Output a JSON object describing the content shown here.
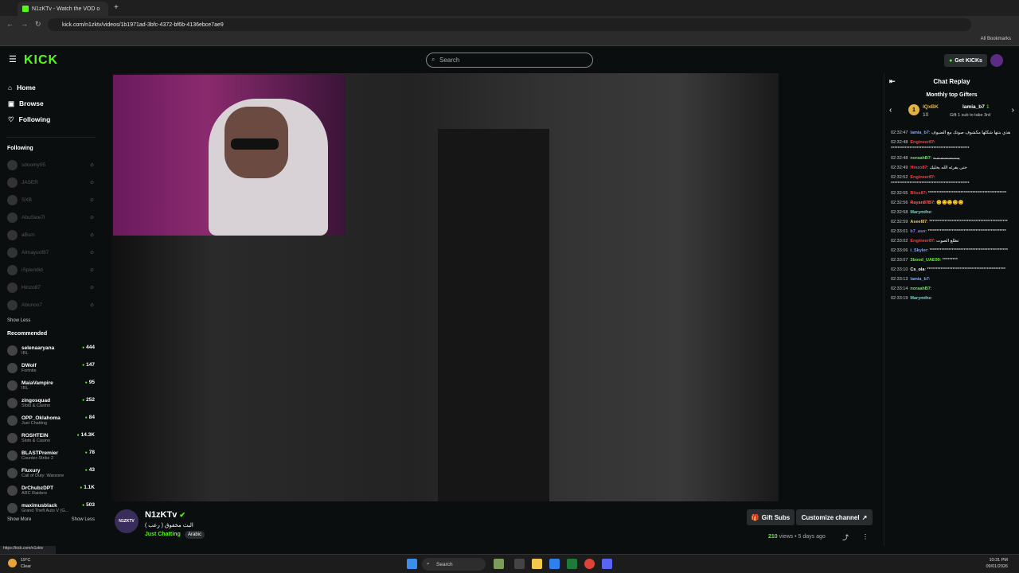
{
  "browser": {
    "tab_title": "N1zKTv - Watch the VOD o",
    "url": "kick.com/n1zktv/videos/1b1971ad-3bfc-4372-bf6b-4136ebce7ae9",
    "bookmarks_label": "All Bookmarks",
    "status_url": "https://kick.com/n1zktv"
  },
  "header": {
    "logo": "KICK",
    "search_placeholder": "Search",
    "get_kicks": "Get KICKs"
  },
  "sidebar": {
    "nav": [
      {
        "label": "Home",
        "icon": "home-icon"
      },
      {
        "label": "Browse",
        "icon": "browse-icon"
      },
      {
        "label": "Following",
        "icon": "heart-icon"
      }
    ],
    "following_title": "Following",
    "following": [
      "sdoomy05",
      "JASER",
      "SXB",
      "AbuSwe7l",
      "aBsm",
      "Almayuof87",
      "iSplendid",
      "Hinzo87",
      "Abunoo7"
    ],
    "show_less_following": "Show Less",
    "recommended_title": "Recommended",
    "recommended": [
      {
        "name": "selenaaryana",
        "cat": "IRL",
        "views": "444"
      },
      {
        "name": "DWolf",
        "cat": "Fortnite",
        "views": "147"
      },
      {
        "name": "MaiaVampire",
        "cat": "IRL",
        "views": "95"
      },
      {
        "name": "zingosquad",
        "cat": "Slots & Casino",
        "views": "252"
      },
      {
        "name": "OPP_Oklahoma",
        "cat": "Just Chatting",
        "views": "84"
      },
      {
        "name": "ROSHTEIN",
        "cat": "Slots & Casino",
        "views": "14.3K"
      },
      {
        "name": "BLASTPremier",
        "cat": "Counter-Strike 2",
        "views": "78"
      },
      {
        "name": "Fluxury",
        "cat": "Call of Duty: Warzone",
        "views": "43"
      },
      {
        "name": "DrChubzDPT",
        "cat": "ARC Raiders",
        "views": "1.1K"
      },
      {
        "name": "maximusblack",
        "cat": "Grand Theft Auto V (G...",
        "views": "503"
      }
    ],
    "show_more": "Show More",
    "show_less": "Show Less"
  },
  "channel": {
    "avatar_text": "N1ZKTV",
    "name": "N1zKTv",
    "title": "البث مخفوق ( رعب )",
    "category": "Just Chatting",
    "tag": "Arabic",
    "gift_subs": "Gift Subs",
    "customize": "Customize channel",
    "views": "210",
    "views_label": "views",
    "age": "5 days ago"
  },
  "chat": {
    "title": "Chat Replay",
    "gifters_title": "Monthly top Gifters",
    "gifter1_name": "lQxBK",
    "gifter1_count": "10",
    "gifter2_name": "lamia_b7",
    "gifter2_count": "1",
    "gift_cta": "Gift 1 sub to take 3rd",
    "messages": [
      {
        "ts": "02:32:47",
        "user": "lamia_b7",
        "color": "#7aa7ff",
        "text": "هذي بنتها شكلها مكشوف صوتك مع الضيوف"
      },
      {
        "ts": "02:32:48",
        "user": "Engineer87",
        "color": "#ff3b3b",
        "text": "**********************************************"
      },
      {
        "ts": "02:32:48",
        "user": "noraahB7",
        "color": "#6de06d",
        "text": "يسسسسسسه"
      },
      {
        "ts": "02:32:49",
        "user": "Hinzo87",
        "color": "#ff3b3b",
        "text": "حتى يقرئه الله يخليك"
      },
      {
        "ts": "02:32:52",
        "user": "Engineer87",
        "color": "#ff3b3b",
        "text": "**********************************************"
      },
      {
        "ts": "02:32:55",
        "user": "Bliss87",
        "color": "#ff3b3b",
        "text": "**********************************************"
      },
      {
        "ts": "02:32:56",
        "user": "Rayan87B7",
        "color": "#ff5f5f",
        "text": "😊😊😊😊😊"
      },
      {
        "ts": "02:32:58",
        "user": "Marymthe",
        "color": "#6fd3c8",
        "text": ""
      },
      {
        "ts": "02:32:59",
        "user": "Aseel87",
        "color": "#e9c46a",
        "text": "**********************************************"
      },
      {
        "ts": "02:33:01",
        "user": "b7_aso",
        "color": "#8a7bff",
        "text": "**********************************************"
      },
      {
        "ts": "02:33:02",
        "user": "Engineer87",
        "color": "#ff3b3b",
        "text": "تطلع الصوت"
      },
      {
        "ts": "02:33:06",
        "user": "i_Skyler",
        "color": "#7aa7ff",
        "text": "**********************************************"
      },
      {
        "ts": "02:33:07",
        "user": "3bood_UAE99",
        "color": "#53fc18",
        "text": "*********"
      },
      {
        "ts": "02:33:10",
        "user": "Cs_ola",
        "color": "#ffffff",
        "text": "**********************************************"
      },
      {
        "ts": "02:33:13",
        "user": "lamia_b7",
        "color": "#7aa7ff",
        "text": ""
      },
      {
        "ts": "02:33:14",
        "user": "noraahB7",
        "color": "#6de06d",
        "text": ""
      },
      {
        "ts": "02:33:19",
        "user": "Marymthe",
        "color": "#6fd3c8",
        "text": ""
      }
    ]
  },
  "taskbar": {
    "temp": "19°C",
    "weather": "Clear",
    "search": "Search",
    "time": "10:31 PM",
    "date": "09/01/2026"
  }
}
